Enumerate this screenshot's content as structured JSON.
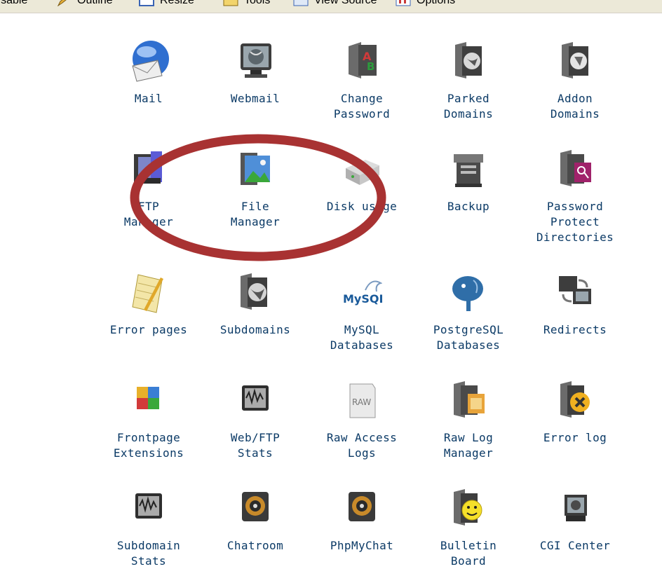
{
  "toolbar": {
    "items": [
      {
        "label": "Disable",
        "icon": "disable-icon"
      },
      {
        "label": "Outline",
        "icon": "pencil-icon"
      },
      {
        "label": "Resize",
        "icon": "resize-icon"
      },
      {
        "label": "Tools",
        "icon": "tools-icon"
      },
      {
        "label": "View Source",
        "icon": "view-source-icon"
      },
      {
        "label": "Options",
        "icon": "options-icon"
      }
    ]
  },
  "cpanel": {
    "rows": [
      [
        {
          "label": "Mail",
          "icon": "mail-envelope-icon"
        },
        {
          "label": "Webmail",
          "icon": "monitor-globe-icon"
        },
        {
          "label": "Change\nPassword",
          "icon": "change-password-icon"
        },
        {
          "label": "Parked\nDomains",
          "icon": "parked-domains-icon"
        },
        {
          "label": "Addon\nDomains",
          "icon": "addon-domains-icon"
        }
      ],
      [
        {
          "label": "FTP\nManager",
          "icon": "ftp-manager-icon"
        },
        {
          "label": "File\nManager",
          "icon": "file-manager-icon"
        },
        {
          "label": "Disk usage",
          "icon": "disk-usage-icon"
        },
        {
          "label": "Backup",
          "icon": "backup-icon"
        },
        {
          "label": "Password\nProtect\nDirectories",
          "icon": "password-protect-icon"
        }
      ],
      [
        {
          "label": "Error pages",
          "icon": "error-pages-icon"
        },
        {
          "label": "Subdomains",
          "icon": "subdomains-icon"
        },
        {
          "label": "MySQL\nDatabases",
          "icon": "mysql-icon"
        },
        {
          "label": "PostgreSQL\nDatabases",
          "icon": "postgresql-elephant-icon"
        },
        {
          "label": "Redirects",
          "icon": "redirects-icon"
        }
      ],
      [
        {
          "label": "Frontpage\nExtensions",
          "icon": "frontpage-icon"
        },
        {
          "label": "Web/FTP\nStats",
          "icon": "web-ftp-stats-icon"
        },
        {
          "label": "Raw Access\nLogs",
          "icon": "raw-access-logs-icon"
        },
        {
          "label": "Raw Log\nManager",
          "icon": "raw-log-manager-icon"
        },
        {
          "label": "Error log",
          "icon": "error-log-icon"
        }
      ],
      [
        {
          "label": "Subdomain\nStats",
          "icon": "subdomain-stats-icon"
        },
        {
          "label": "Chatroom",
          "icon": "chatroom-icon"
        },
        {
          "label": "PhpMyChat",
          "icon": "phpmychat-icon"
        },
        {
          "label": "Bulletin\nBoard",
          "icon": "bulletin-board-icon"
        },
        {
          "label": "CGI Center",
          "icon": "cgi-center-icon"
        }
      ]
    ],
    "icon_labels": {
      "mysql_text": "MySQL",
      "raw_text": "RAW"
    }
  },
  "colors": {
    "label": "#0b3a66",
    "annotation": "#a83232",
    "toolbar_bg": "#ece9d8"
  }
}
